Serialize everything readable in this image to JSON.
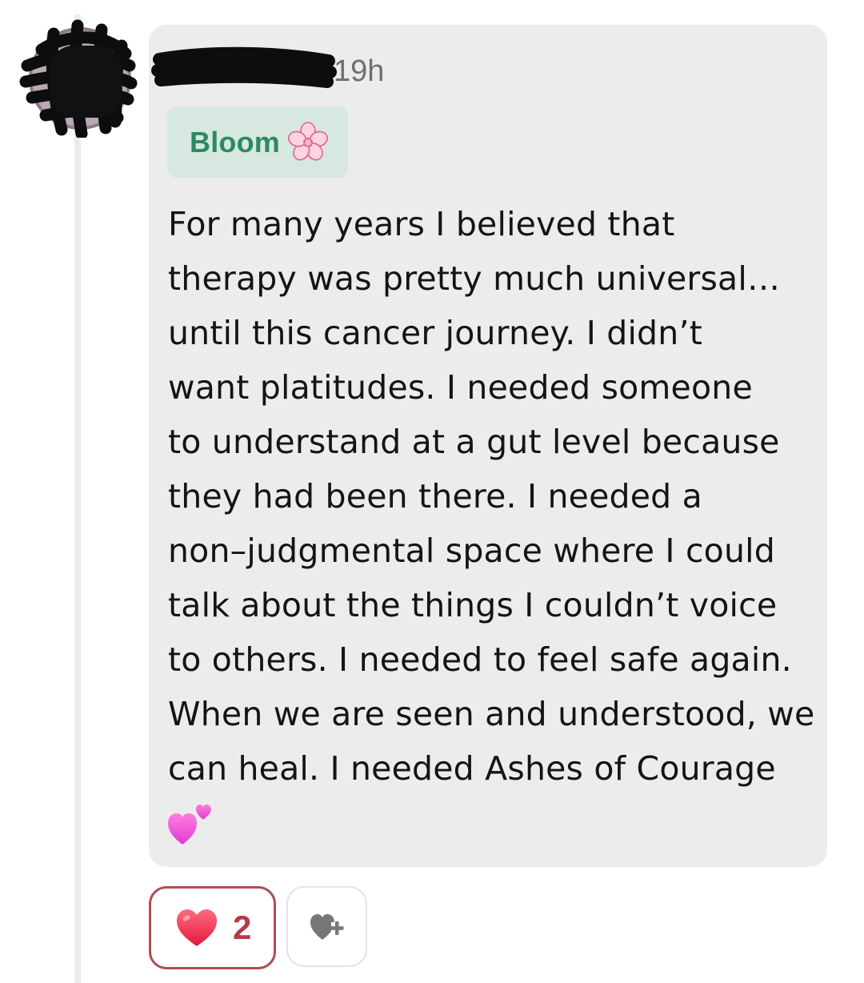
{
  "comment": {
    "timestamp": "19h",
    "flair": {
      "label": "Bloom",
      "icon": "cherry-blossom-icon"
    },
    "body_lines": [
      "For many years I believed that",
      "therapy was pretty much universal…",
      "until this cancer journey. I didn’t",
      "want platitudes. I needed someone",
      "to understand at a gut level because",
      "they had been there. I needed a",
      "non–judgmental space where I could",
      "talk about the things I couldn’t voice",
      "to others. I needed to feel safe again.",
      "When we are seen and understood, we",
      "can heal. I needed Ashes of Courage"
    ],
    "trailing_emoji": "two-hearts-icon"
  },
  "reactions": {
    "heart": {
      "icon": "red-heart-icon",
      "count": "2"
    },
    "add_reaction": {
      "icon": "add-reaction-heart-icon"
    }
  },
  "colors": {
    "card_background": "#ececec",
    "flair_background": "#d6e8df",
    "flair_text": "#2b8a61",
    "reaction_border": "#b14b54",
    "reaction_count": "#b53a48",
    "timestamp": "#6f6f6f"
  }
}
